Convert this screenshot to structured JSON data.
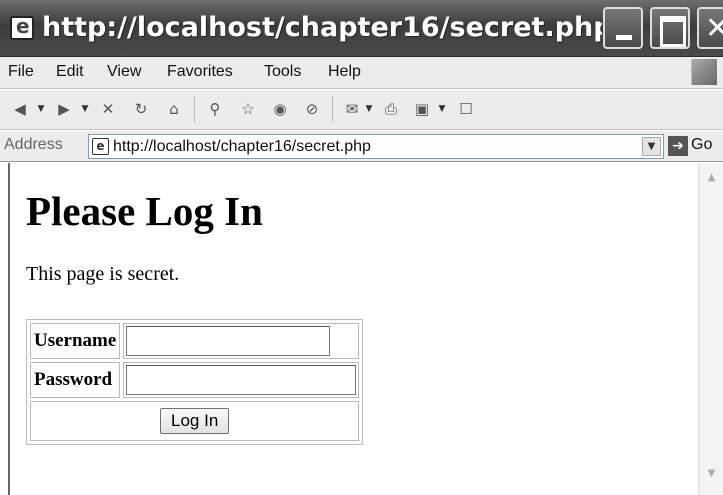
{
  "window": {
    "title": "http://localhost/chapter16/secret.php ..."
  },
  "menu": {
    "items": [
      "File",
      "Edit",
      "View",
      "Favorites",
      "Tools",
      "Help"
    ]
  },
  "toolbar": {
    "icons": [
      "back-icon",
      "forward-icon",
      "stop-icon",
      "refresh-icon",
      "home-icon",
      "search-icon",
      "favorites-icon",
      "media-icon",
      "history-icon",
      "mail-icon",
      "print-icon",
      "edit-icon",
      "discuss-icon"
    ]
  },
  "address": {
    "label": "Address",
    "url": "http://localhost/chapter16/secret.php",
    "go_label": "Go"
  },
  "page": {
    "heading": "Please Log In",
    "intro": "This page is secret.",
    "username_label": "Username",
    "password_label": "Password",
    "username_value": "",
    "password_value": "",
    "submit_label": "Log In"
  }
}
